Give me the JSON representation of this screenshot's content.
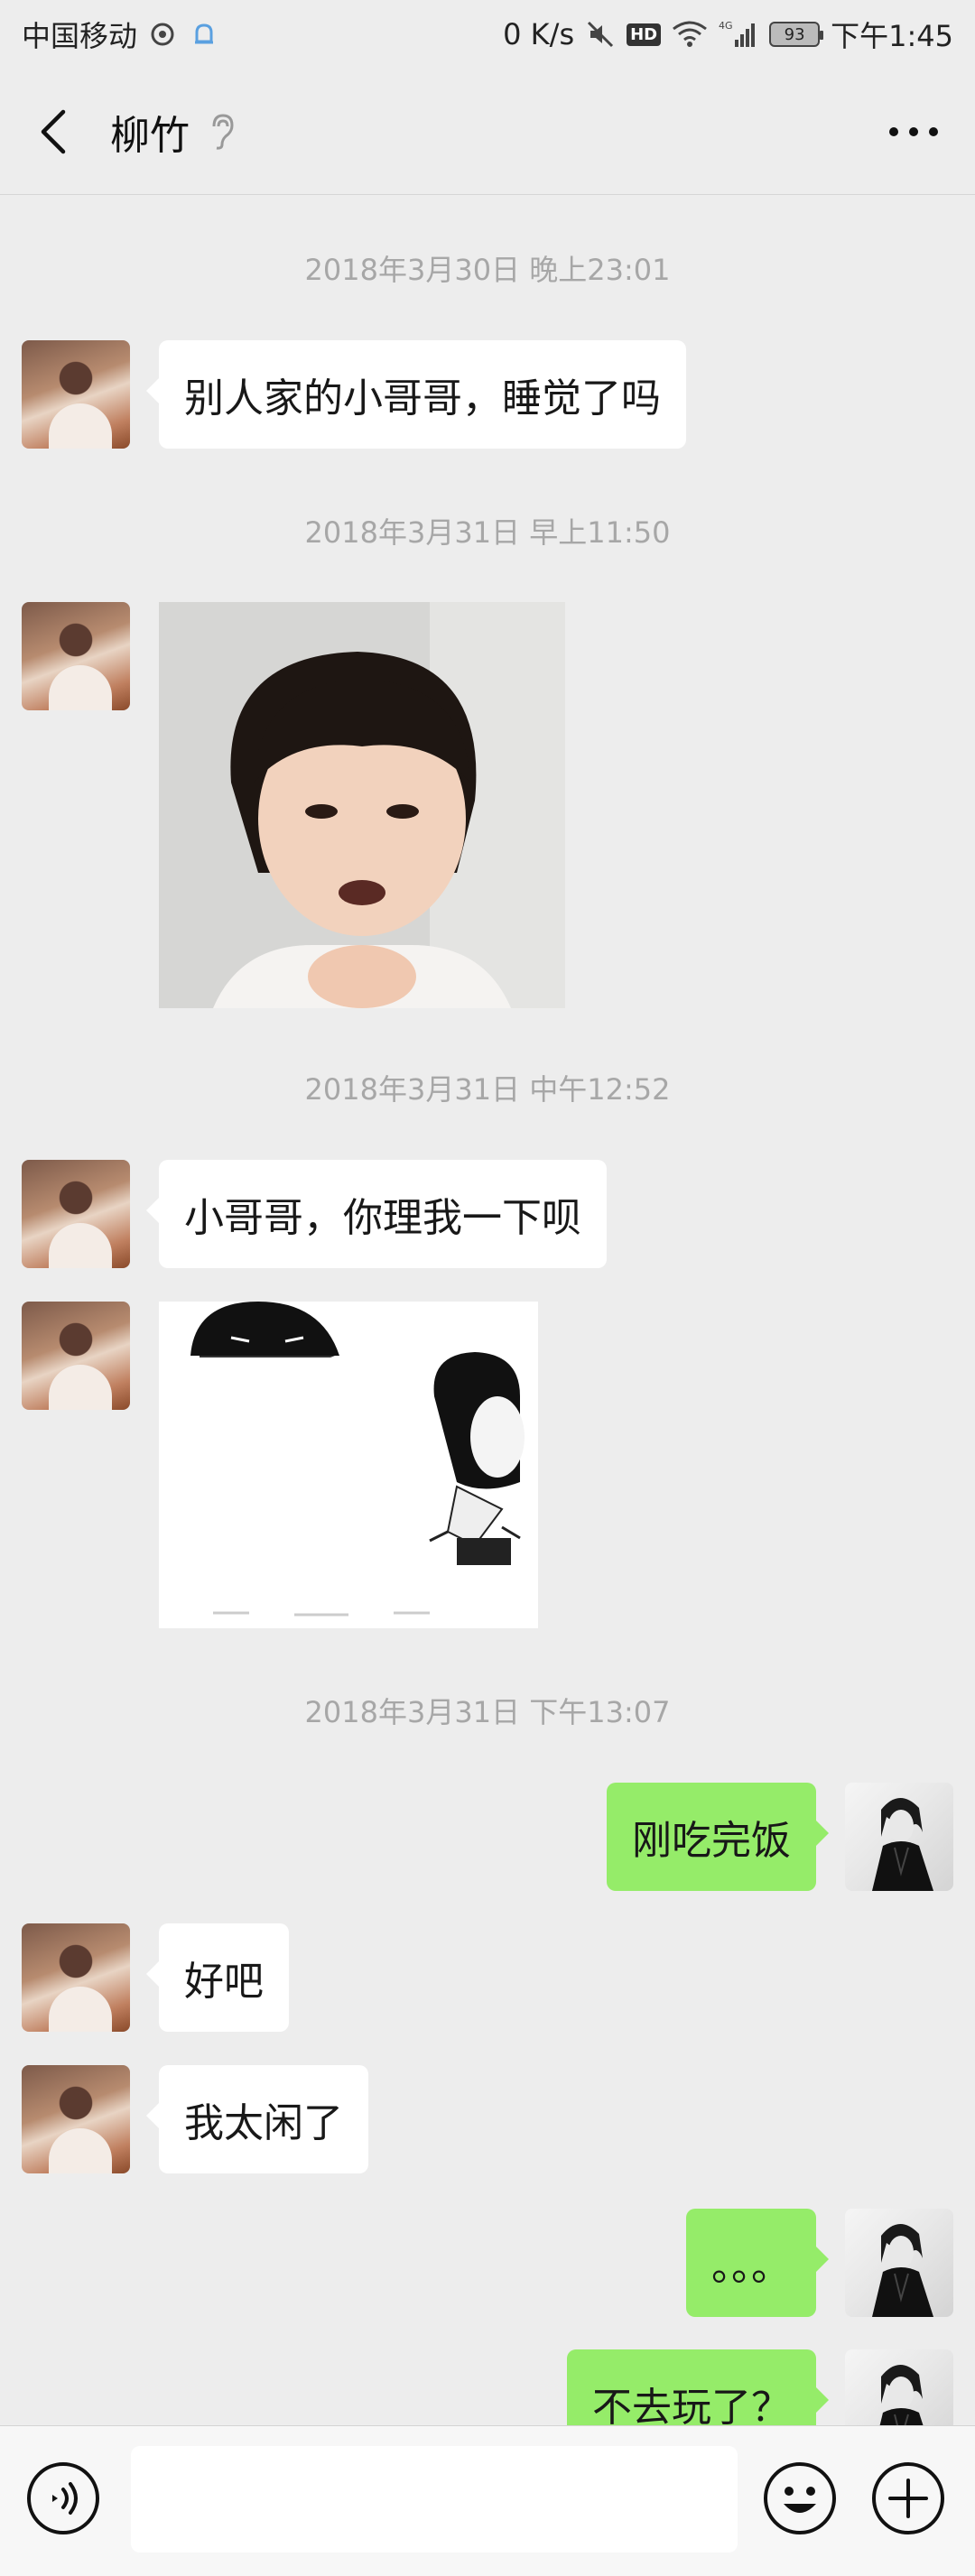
{
  "status_bar": {
    "carrier": "中国移动",
    "speed": "0 K/s",
    "hd": "HD",
    "network": "4G",
    "battery": "93",
    "time": "下午1:45"
  },
  "header": {
    "title": "柳竹"
  },
  "messages": {
    "ts1": "2018年3月30日 晚上23:01",
    "m1": "别人家的小哥哥，睡觉了吗",
    "ts2": "2018年3月31日 早上11:50",
    "ts3": "2018年3月31日 中午12:52",
    "m3": "小哥哥，你理我一下呗",
    "ts4": "2018年3月31日 下午13:07",
    "m5": "刚吃完饭",
    "m6": "好吧",
    "m7": "我太闲了",
    "m8": "。。。",
    "m9": "不去玩了？"
  },
  "input": {
    "value": ""
  },
  "colors": {
    "background": "#ededed",
    "outgoing_bubble": "#95ec69",
    "incoming_bubble": "#ffffff",
    "timestamp": "#a7a7a7"
  },
  "icons": [
    "back-arrow-icon",
    "ear-icon",
    "more-icon",
    "voice-icon",
    "emoji-icon",
    "plus-icon"
  ]
}
